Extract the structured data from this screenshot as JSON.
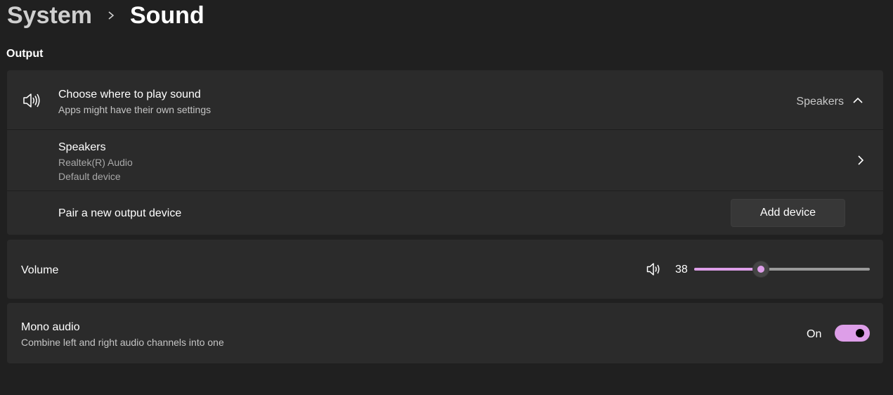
{
  "breadcrumb": {
    "parent": "System",
    "current": "Sound"
  },
  "output": {
    "section_title": "Output",
    "choose": {
      "title": "Choose where to play sound",
      "subtitle": "Apps might have their own settings",
      "selected": "Speakers"
    },
    "speakers": {
      "name": "Speakers",
      "driver": "Realtek(R) Audio",
      "status": "Default device"
    },
    "pair": {
      "label": "Pair a new output device",
      "button_label": "Add device"
    }
  },
  "volume": {
    "label": "Volume",
    "value_text": "38",
    "level": 0.38
  },
  "mono": {
    "title": "Mono audio",
    "subtitle": "Combine left and right audio channels into one",
    "state_label": "On"
  },
  "colors": {
    "accent": "#dd9ee8",
    "background": "#202020",
    "card": "#2b2b2b"
  },
  "icons": {
    "speaker": "speaker-icon",
    "chevron_up": "chevron-up-icon",
    "chevron_right": "chevron-right-icon",
    "breadcrumb_sep": "chevron-right-icon"
  }
}
